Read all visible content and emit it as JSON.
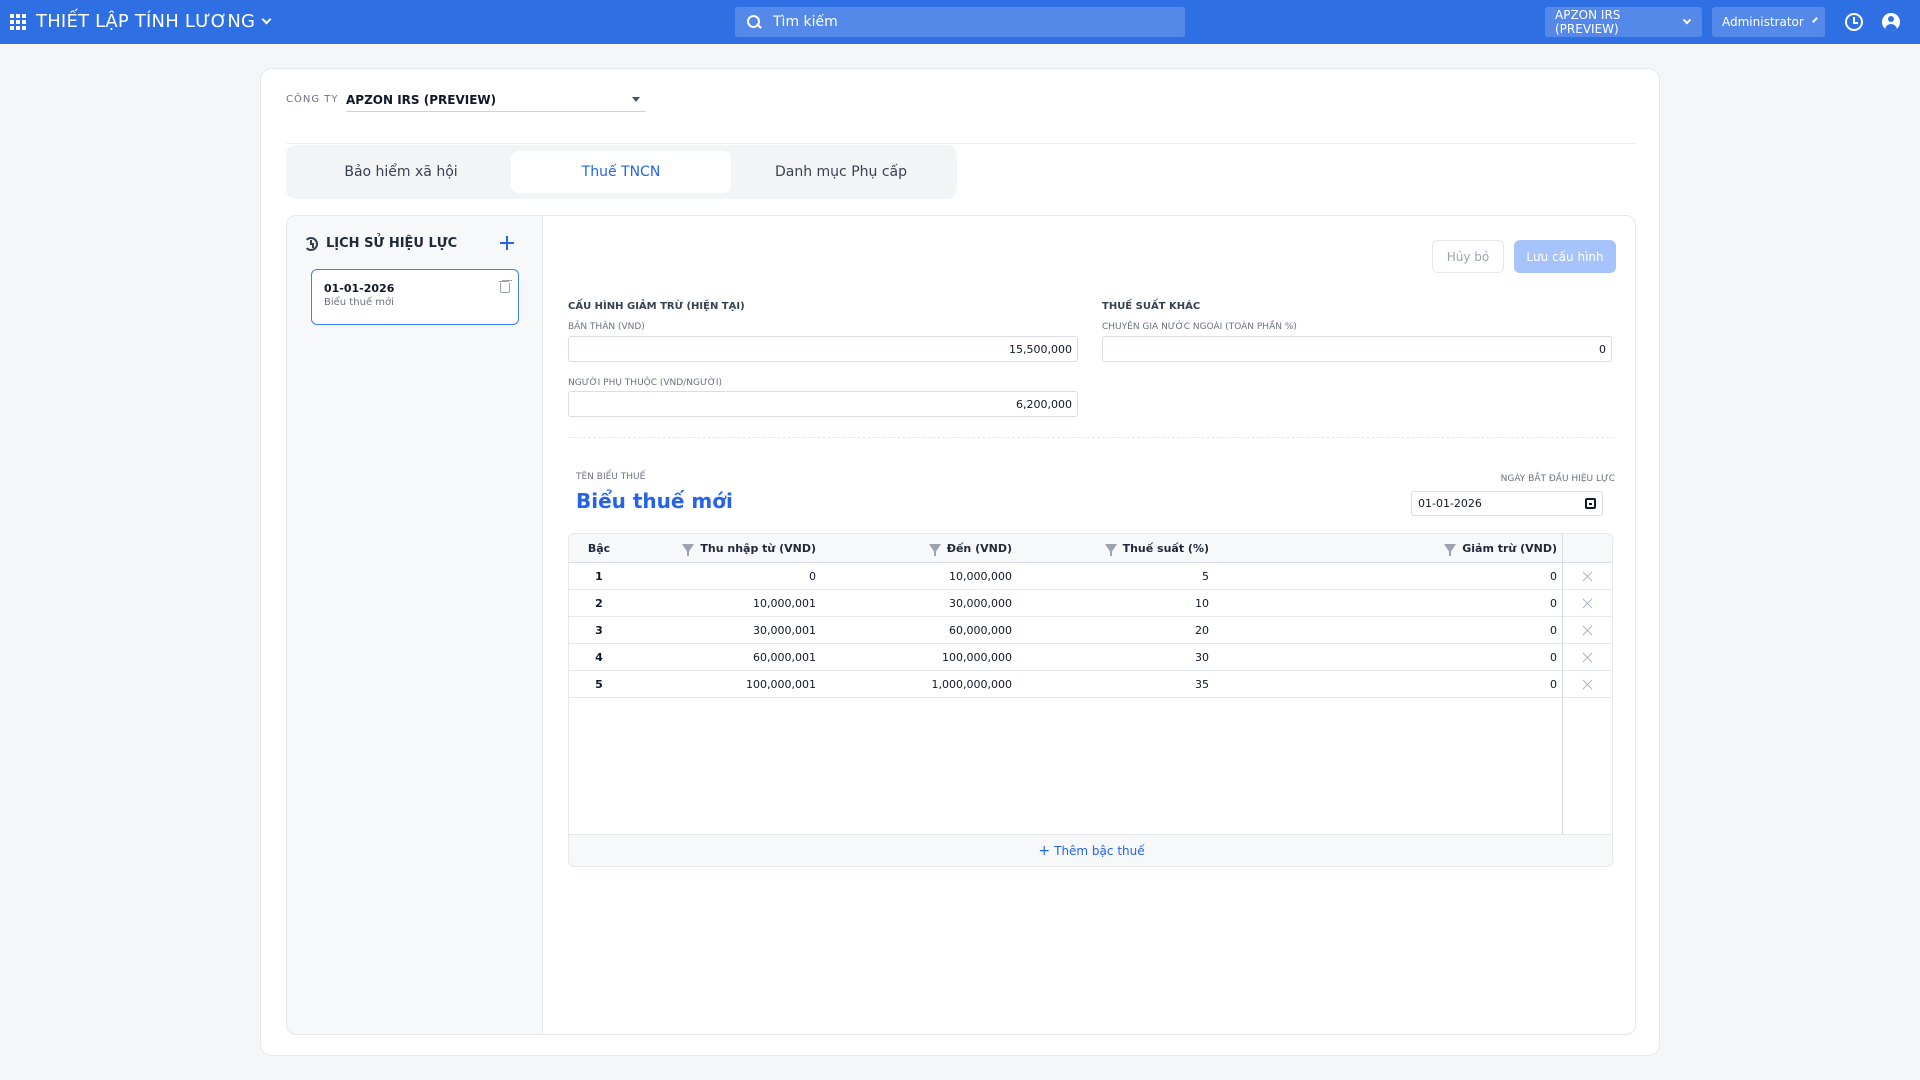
{
  "header": {
    "app_title": "THIẾT LẬP TÍNH LƯƠNG",
    "search_placeholder": "Tìm kiếm",
    "company_dropdown": "APZON IRS (PREVIEW)",
    "user_dropdown": "Administrator",
    "accent_color": "#2f6fe4"
  },
  "company": {
    "label": "CÔNG TY",
    "value": "APZON IRS (PREVIEW)"
  },
  "tabs": [
    {
      "label": "Bảo hiểm xã hội",
      "active": false
    },
    {
      "label": "Thuế TNCN",
      "active": true
    },
    {
      "label": "Danh mục Phụ cấp",
      "active": false
    }
  ],
  "history": {
    "title": "LỊCH SỬ HIỆU LỰC",
    "items": [
      {
        "date": "01-01-2026",
        "name": "Biểu thuế mới"
      }
    ]
  },
  "actions": {
    "cancel": "Hủy bỏ",
    "save": "Lưu cấu hình"
  },
  "deduction": {
    "title": "CẤU HÌNH GIẢM TRỪ (HIỆN TẠI)",
    "self_label": "BẢN THÂN (VND)",
    "self_value": "15,500,000",
    "dependent_label": "NGƯỜI PHỤ THUỘC (VND/NGƯỜI)",
    "dependent_value": "6,200,000"
  },
  "other_rates": {
    "title": "THUẾ SUẤT KHÁC",
    "expat_label": "CHUYÊN GIA NƯỚC NGOÀI (TOÀN PHẦN %)",
    "expat_value": "0"
  },
  "schedule": {
    "name_label": "TÊN BIỂU THUẾ",
    "name": "Biểu thuế mới",
    "start_label": "NGÀY BẮT ĐẦU HIỆU LỰC",
    "start_date": "01-01-2026"
  },
  "table": {
    "headers": [
      "Bậc",
      "Thu nhập từ (VND)",
      "Đến (VND)",
      "Thuế suất (%)",
      "Giảm trừ (VND)"
    ],
    "rows": [
      [
        "1",
        "0",
        "10,000,000",
        "5",
        "0"
      ],
      [
        "2",
        "10,000,001",
        "30,000,000",
        "10",
        "0"
      ],
      [
        "3",
        "30,000,001",
        "60,000,000",
        "20",
        "0"
      ],
      [
        "4",
        "60,000,001",
        "100,000,000",
        "30",
        "0"
      ],
      [
        "5",
        "100,000,001",
        "1,000,000,000",
        "35",
        "0"
      ]
    ],
    "add_label": "Thêm bậc thuế"
  }
}
